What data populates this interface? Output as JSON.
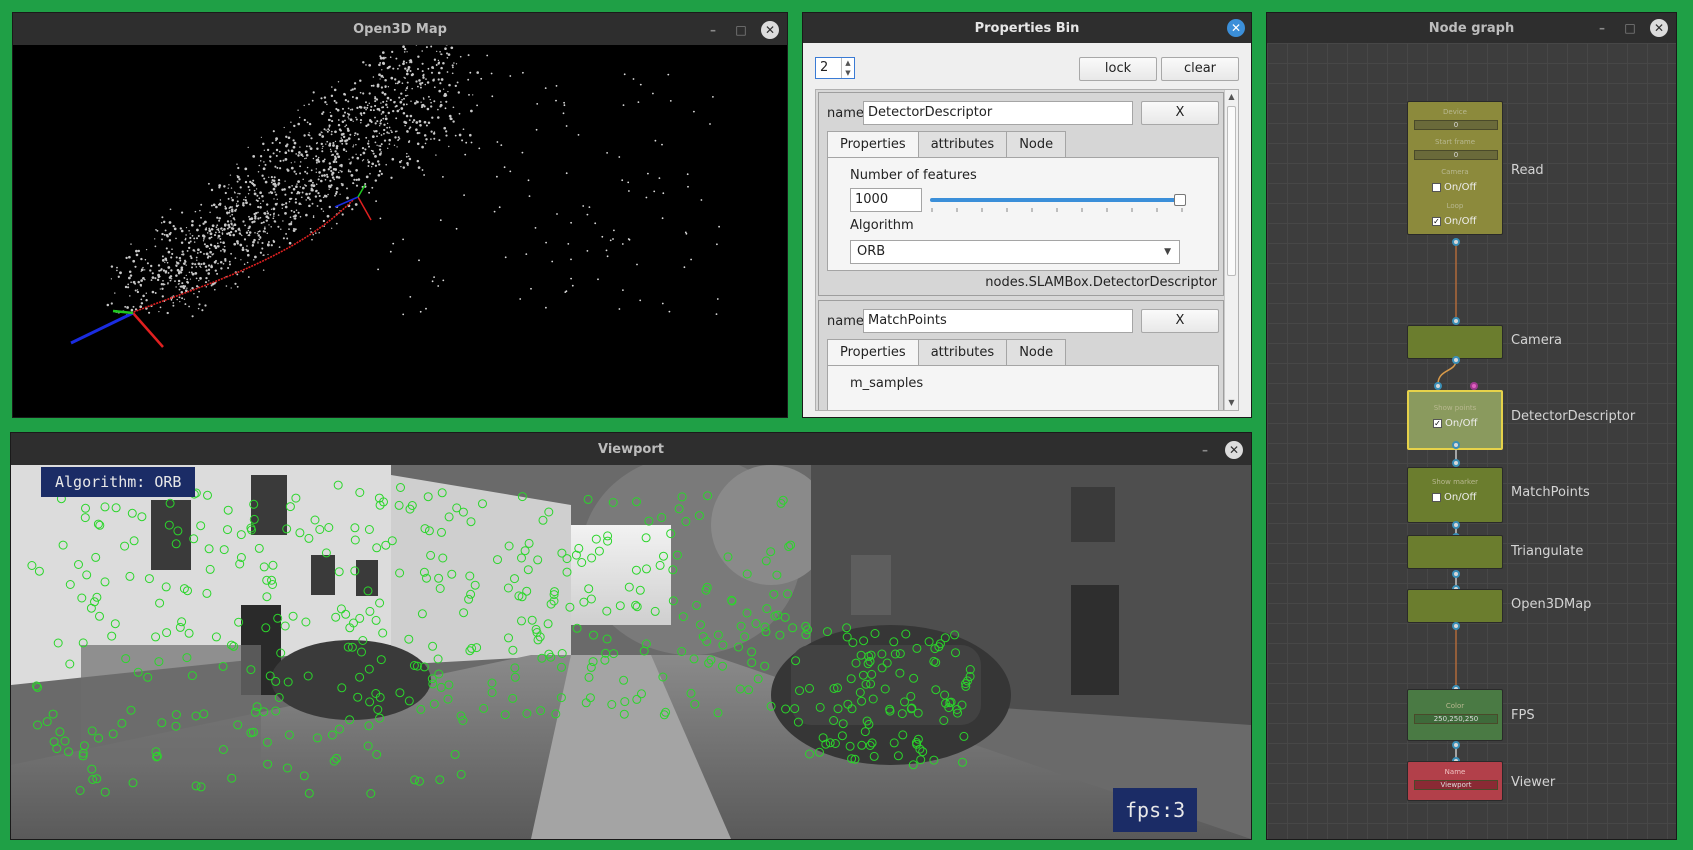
{
  "map_window": {
    "title": "Open3D Map",
    "minimize": "–",
    "maximize": "□",
    "close": "✕"
  },
  "props_window": {
    "title": "Properties Bin",
    "close": "✕",
    "spin_value": "2",
    "lock_label": "lock",
    "clear_label": "clear",
    "panels": [
      {
        "name_label": "name",
        "name_value": "DetectorDescriptor",
        "close_label": "X",
        "tabs": [
          "Properties",
          "attributes",
          "Node"
        ],
        "num_features_label": "Number of features",
        "num_features_value": "1000",
        "slider_fraction": 1.0,
        "algorithm_label": "Algorithm",
        "algorithm_value": "ORB",
        "path": "nodes.SLAMBox.DetectorDescriptor"
      },
      {
        "name_label": "name",
        "name_value": "MatchPoints",
        "close_label": "X",
        "tabs": [
          "Properties",
          "attributes",
          "Node"
        ],
        "first_prop_label": "m_samples"
      }
    ]
  },
  "viewport_window": {
    "title": "Viewport",
    "minimize": "–",
    "close": "✕",
    "algorithm_overlay": "Algorithm: ORB",
    "fps_overlay": "fps:3"
  },
  "graph_window": {
    "title": "Node graph",
    "minimize": "–",
    "maximize": "□",
    "close": "✕",
    "nodes": [
      {
        "label": "Read",
        "color": "#8c8a3c",
        "fields": [
          {
            "caption": "Device",
            "value": "0"
          },
          {
            "caption": "Start frame",
            "value": "0"
          }
        ],
        "checks": [
          {
            "caption": "Camera",
            "label": "On/Off",
            "checked": false
          },
          {
            "caption": "Loop",
            "label": "On/Off",
            "checked": true
          }
        ]
      },
      {
        "label": "Camera",
        "color": "#6b7d2e"
      },
      {
        "label": "DetectorDescriptor",
        "color": "#8a9a5e",
        "selected_border": "#e6d24a",
        "checks": [
          {
            "caption": "Show points",
            "label": "On/Off",
            "checked": true
          }
        ]
      },
      {
        "label": "MatchPoints",
        "color": "#6b7d2e",
        "checks": [
          {
            "caption": "Show marker",
            "label": "On/Off",
            "checked": false
          }
        ]
      },
      {
        "label": "Triangulate",
        "color": "#6b7d2e"
      },
      {
        "label": "Open3DMap",
        "color": "#6b7d2e"
      },
      {
        "label": "FPS",
        "color": "#4a7a44",
        "fields": [
          {
            "caption": "Color",
            "value": "250,250,250"
          }
        ]
      },
      {
        "label": "Viewer",
        "color": "#b2404a",
        "fields": [
          {
            "caption": "Name",
            "value": "Viewport"
          }
        ]
      }
    ]
  },
  "colors": {
    "desktop": "#1fa046",
    "keypoint": "#2bd62b",
    "overlay_bg": "#1b2c66",
    "slider": "#3b8fd9"
  }
}
